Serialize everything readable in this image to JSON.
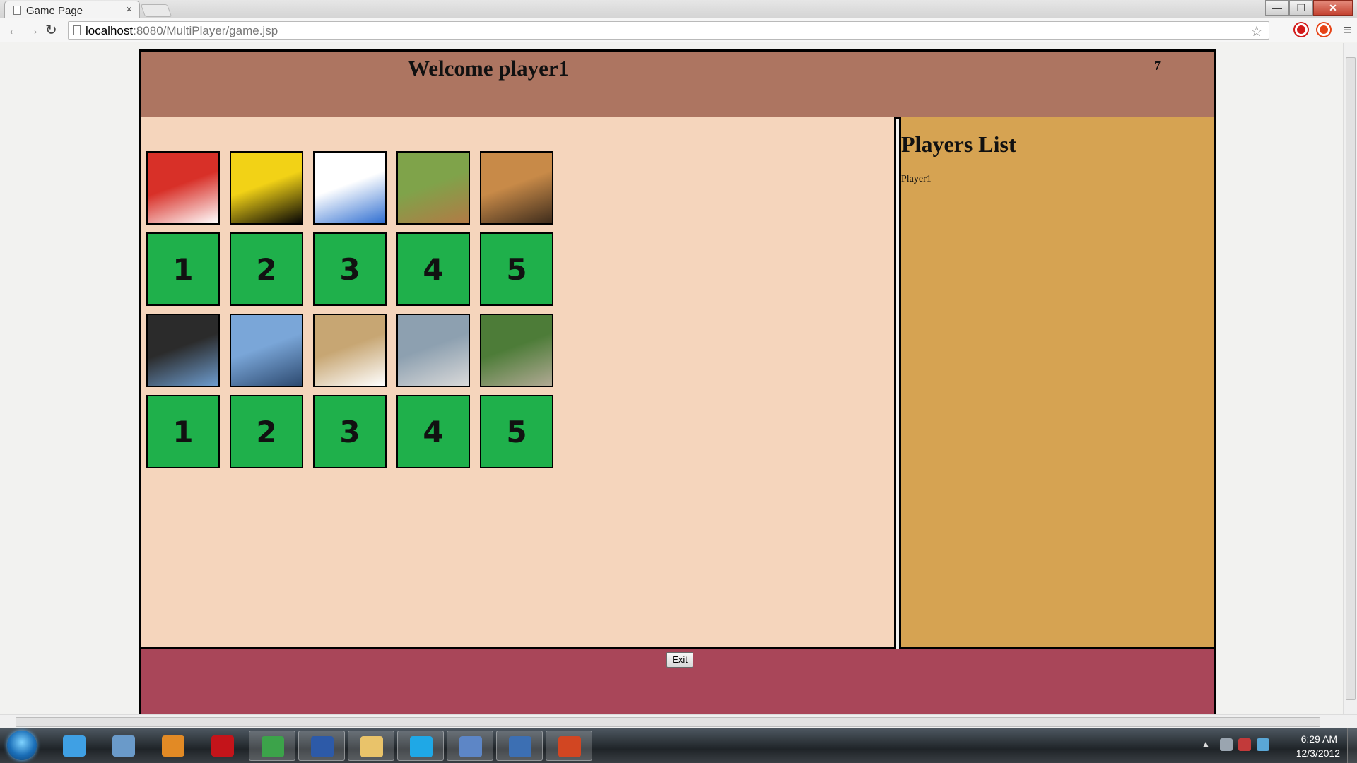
{
  "browser": {
    "tab_title": "Game Page",
    "tab_close": "×",
    "url_host": "localhost",
    "url_rest": ":8080/MultiPlayer/game.jsp",
    "back": "←",
    "forward": "→",
    "reload": "↻",
    "star": "☆",
    "menu": "≡",
    "min": "—",
    "max": "❐",
    "close": "✕"
  },
  "header": {
    "welcome": "Welcome player1",
    "counter": "7"
  },
  "grid": {
    "picture_rows": [
      [
        {
          "name": "apple-image",
          "colors": [
            "#d83028",
            "#ffffff"
          ]
        },
        {
          "name": "banana-image",
          "colors": [
            "#f2d216",
            "#050505"
          ]
        },
        {
          "name": "clouds-image",
          "colors": [
            "#ffffff",
            "#2f6ed1"
          ]
        },
        {
          "name": "deer-image",
          "colors": [
            "#7fa34a",
            "#b27a45"
          ]
        },
        {
          "name": "dog-image",
          "colors": [
            "#c88a48",
            "#3e2c1c"
          ]
        }
      ],
      [
        {
          "name": "eagle-image",
          "colors": [
            "#2b2b2b",
            "#6d9ccf"
          ]
        },
        {
          "name": "lighthouse-image",
          "colors": [
            "#7aa6d8",
            "#2d4a70"
          ]
        },
        {
          "name": "teapot-image",
          "colors": [
            "#c7a673",
            "#ffffff"
          ]
        },
        {
          "name": "train-image",
          "colors": [
            "#8da0b0",
            "#d9d9d9"
          ]
        },
        {
          "name": "abbey-road-image",
          "colors": [
            "#4d7c38",
            "#b1a994"
          ]
        }
      ]
    ],
    "number_rows": [
      [
        "1",
        "2",
        "3",
        "4",
        "5"
      ],
      [
        "1",
        "2",
        "3",
        "4",
        "5"
      ]
    ]
  },
  "players": {
    "title": "Players List",
    "list": [
      "Player1"
    ]
  },
  "footer": {
    "exit_label": "Exit"
  },
  "colors": {
    "header_bg": "#ad7561",
    "game_bg": "#f5d5bc",
    "players_bg": "#d6a352",
    "footer_bg": "#a94659",
    "tile_green": "#1fb04b"
  },
  "taskbar": {
    "time": "6:29 AM",
    "date": "12/3/2012",
    "apps": [
      {
        "name": "internet-explorer-icon",
        "color": "#3fa0e4",
        "active": false
      },
      {
        "name": "photo-viewer-icon",
        "color": "#6a9ac9",
        "active": false
      },
      {
        "name": "media-player-icon",
        "color": "#e28a25",
        "active": false
      },
      {
        "name": "acrobat-icon",
        "color": "#c4141a",
        "active": false
      },
      {
        "name": "chrome-icon",
        "color": "#3ca34a",
        "active": true
      },
      {
        "name": "word-icon",
        "color": "#2d5aa8",
        "active": true
      },
      {
        "name": "explorer-icon",
        "color": "#e9c36a",
        "active": true
      },
      {
        "name": "skype-icon",
        "color": "#1fa8e6",
        "active": true
      },
      {
        "name": "virtualbox-icon",
        "color": "#5d86c6",
        "active": true
      },
      {
        "name": "thunderbird-icon",
        "color": "#3c6fb3",
        "active": true
      },
      {
        "name": "powerpoint-icon",
        "color": "#d24622",
        "active": true
      }
    ]
  }
}
